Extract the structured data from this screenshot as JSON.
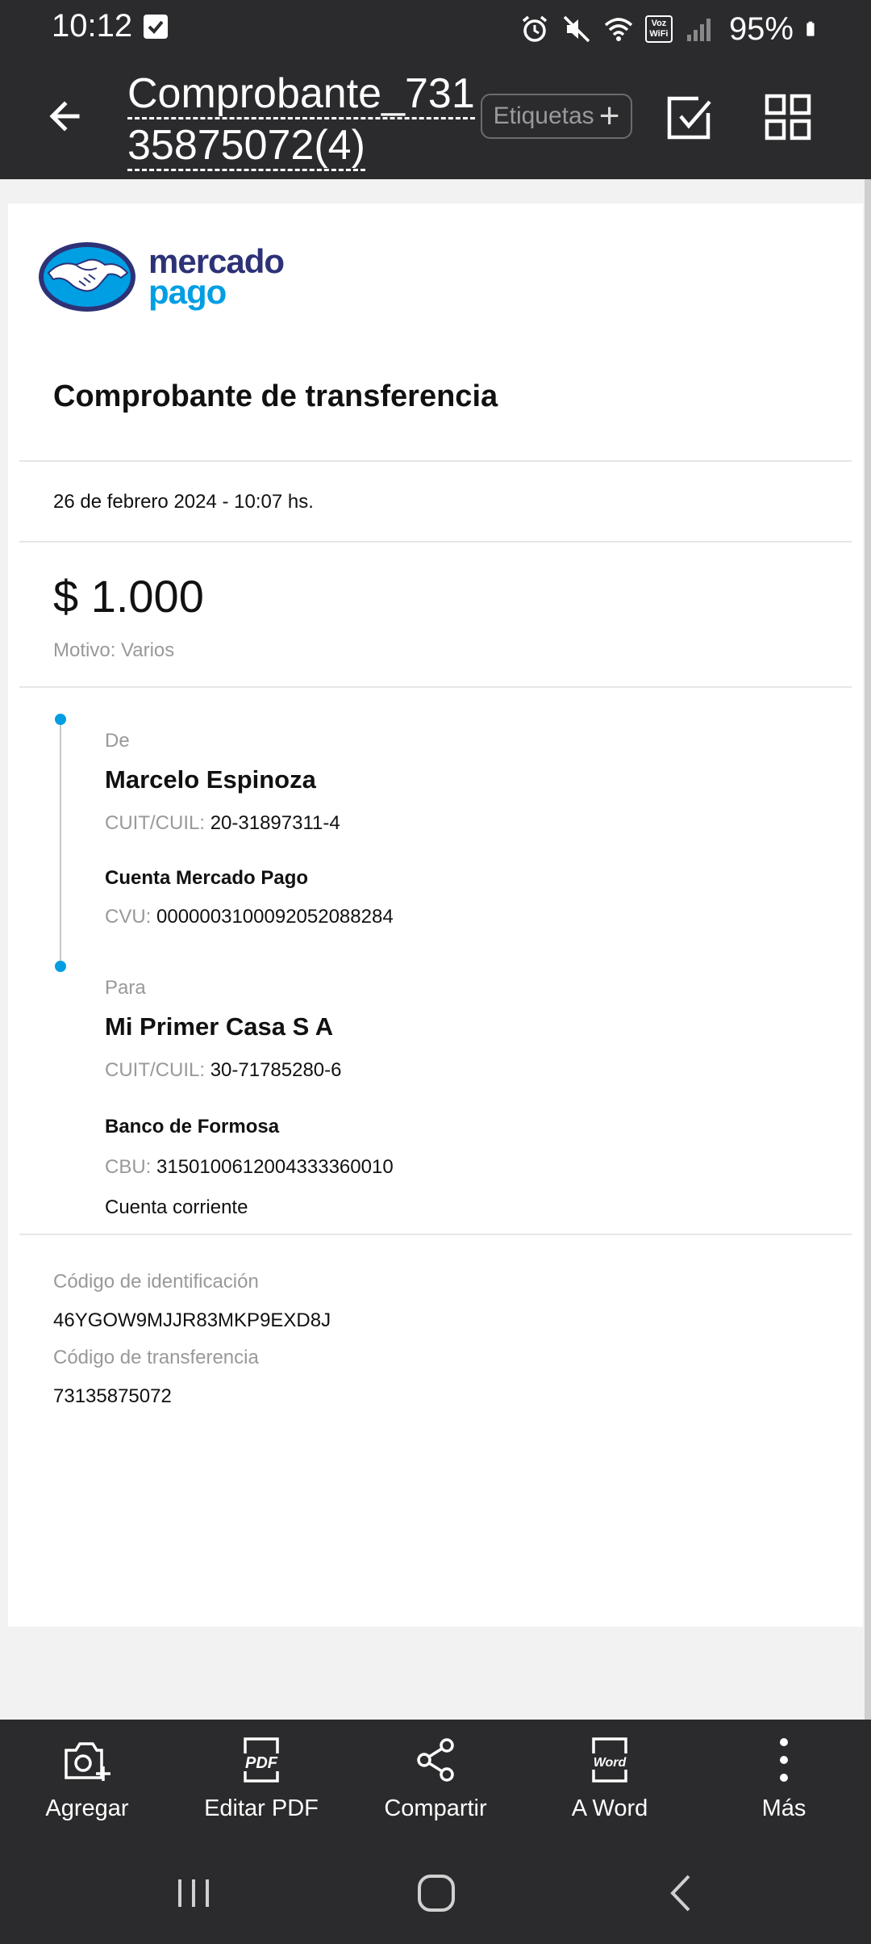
{
  "status_bar": {
    "time": "10:12",
    "voz_line1": "Voz",
    "voz_line2": "WiFi",
    "battery": "95%"
  },
  "header": {
    "title": "Comprobante_73135875072(4)",
    "title_line1": "Comprobante_731",
    "title_line2": "35875072(4)",
    "tags_label": "Etiquetas",
    "tags_plus": "+"
  },
  "document": {
    "brand_line1": "mercado",
    "brand_line2": "pago",
    "heading": "Comprobante de transferencia",
    "date": "26 de febrero 2024 - 10:07 hs.",
    "amount": "$ 1.000",
    "motivo": "Motivo: Varios",
    "from": {
      "label": "De",
      "name": "Marcelo Espinoza",
      "cuit_label": "CUIT/CUIL:",
      "cuit_value": "20-31897311-4",
      "account_type": "Cuenta Mercado Pago",
      "cvu_label": "CVU:",
      "cvu_value": "0000003100092052088284"
    },
    "to": {
      "label": "Para",
      "name": "Mi Primer Casa S A",
      "cuit_label": "CUIT/CUIL:",
      "cuit_value": "30-71785280-6",
      "bank": "Banco de Formosa",
      "cbu_label": "CBU:",
      "cbu_value": "3150100612004333360010",
      "account_kind": "Cuenta corriente"
    },
    "id_code_label": "Código de identificación",
    "id_code_value": "46YGOW9MJJR83MKP9EXD8J",
    "transfer_code_label": "Código de transferencia",
    "transfer_code_value": "73135875072"
  },
  "toolbar": {
    "items": [
      {
        "label": "Agregar",
        "icon": "camera-plus-icon"
      },
      {
        "label": "Editar PDF",
        "icon": "pdf-icon",
        "badge": "PDF"
      },
      {
        "label": "Compartir",
        "icon": "share-icon"
      },
      {
        "label": "A Word",
        "icon": "word-icon",
        "badge": "Word"
      },
      {
        "label": "Más",
        "icon": "more-vertical-icon"
      }
    ]
  },
  "colors": {
    "bar_bg": "#2b2b2d",
    "brand_navy": "#2d3277",
    "brand_blue": "#009ee3"
  }
}
